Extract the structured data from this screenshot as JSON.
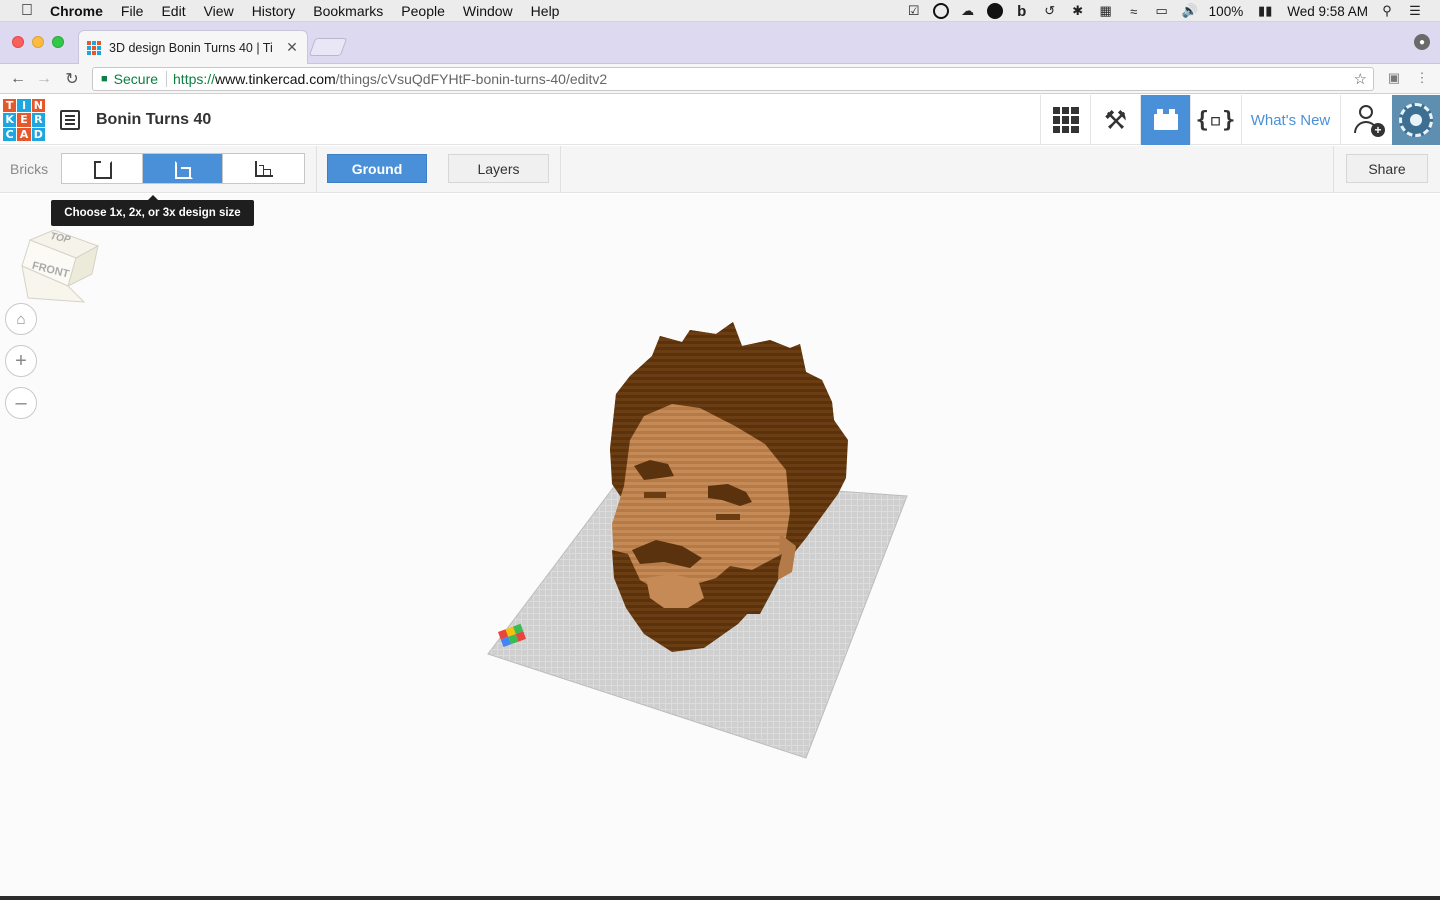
{
  "menubar": {
    "app": "Chrome",
    "items": [
      "File",
      "Edit",
      "View",
      "History",
      "Bookmarks",
      "People",
      "Window",
      "Help"
    ],
    "battery": "100%",
    "clock": "Wed 9:58 AM"
  },
  "browser": {
    "tab_title": "3D design Bonin Turns 40 | Ti",
    "secure_label": "Secure",
    "url_scheme": "https://",
    "url_host": "www.tinkercad.com",
    "url_path": "/things/cVsuQdFYHtF-bonin-turns-40/editv2"
  },
  "app": {
    "logo_letters": [
      "T",
      "I",
      "N",
      "K",
      "E",
      "R",
      "C",
      "A",
      "D"
    ],
    "logo_colors": [
      "#e6572c",
      "#1ea6e0",
      "#e6572c",
      "#1ea6e0",
      "#e6572c",
      "#1ea6e0",
      "#1ea6e0",
      "#e6572c",
      "#1ea6e0"
    ],
    "design_title": "Bonin Turns 40",
    "whats_new": "What's New",
    "accent": "#4a90d9"
  },
  "toolbar": {
    "bricks_label": "Bricks",
    "ground_label": "Ground",
    "layers_label": "Layers",
    "share_label": "Share"
  },
  "workspace": {
    "tooltip": "Choose 1x, 2x, or 3x design size",
    "viewcube_top": "TOP",
    "viewcube_front": "FRONT"
  }
}
